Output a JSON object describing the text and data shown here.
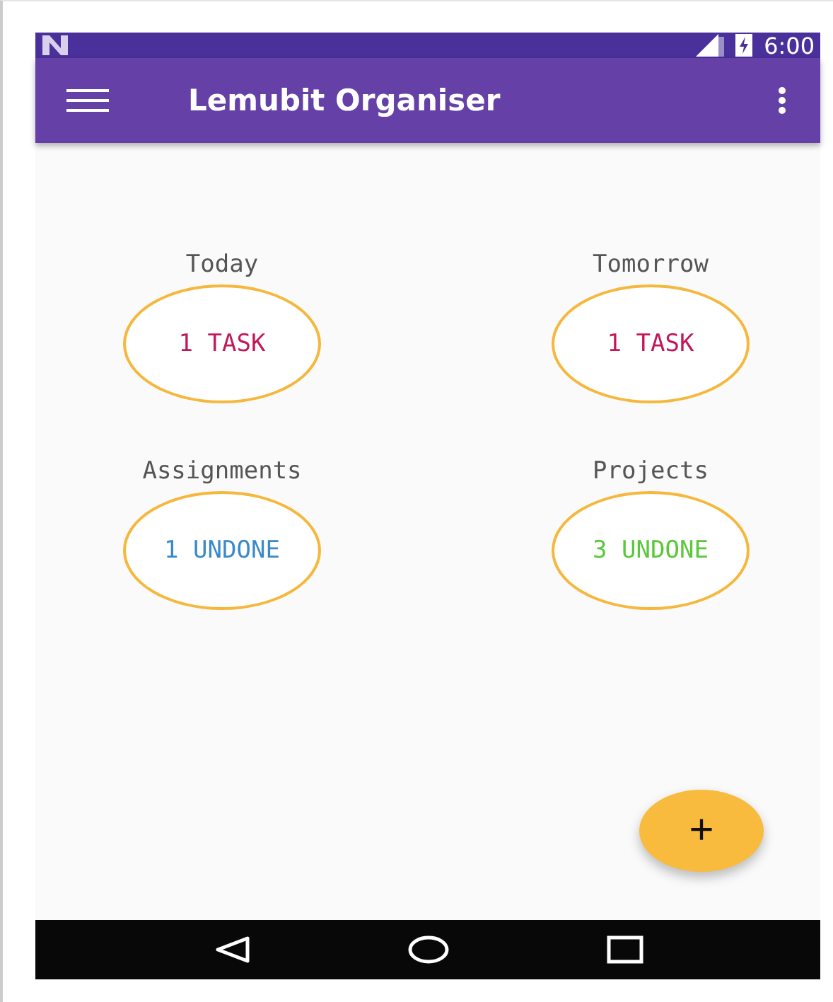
{
  "status_bar": {
    "time": "6:00"
  },
  "app_bar": {
    "title": "Lemubit Organiser"
  },
  "summaries": [
    {
      "label": "Today",
      "count": "1 TASK",
      "color": "#c2185b"
    },
    {
      "label": "Tomorrow",
      "count": "1 TASK",
      "color": "#c2185b"
    },
    {
      "label": "Assignments",
      "count": "1 UNDONE",
      "color": "#3a8ac9"
    },
    {
      "label": "Projects",
      "count": "3 UNDONE",
      "color": "#5ac83a"
    }
  ],
  "fab": {
    "label": "+"
  }
}
